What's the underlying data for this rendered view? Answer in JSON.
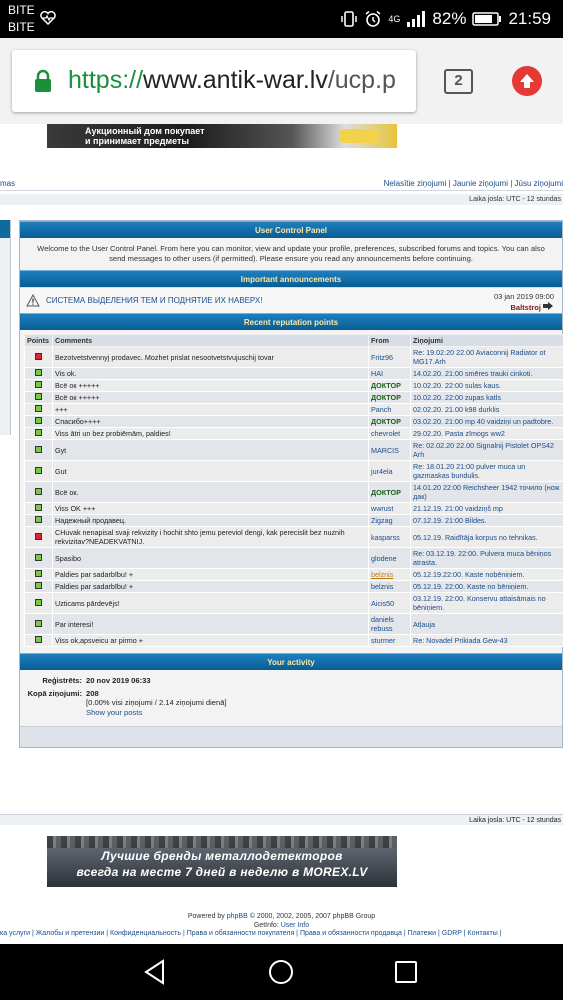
{
  "status_bar": {
    "carrier1": "BITE",
    "carrier2": "BITE",
    "net_label": "4G",
    "battery": "82%",
    "time": "21:59"
  },
  "browser": {
    "url_scheme": "https://",
    "url_host": "www.antik-war.lv",
    "url_path": "/ucp.p",
    "tab_count": "2"
  },
  "banner_top": {
    "line1": "Аукционный дом покупает",
    "line2": "и принимает предметы"
  },
  "top_links": {
    "left": "mas",
    "new_posts": "Nelasītie ziņojumi",
    "sep": " | ",
    "new_topics": "Jaunie ziņojumi",
    "your_posts": "Jūsu ziņojumi"
  },
  "timezone_top": "Laika josla: UTC - 12 stundas",
  "ucp": {
    "title": "User Control Panel",
    "welcome": "Welcome to the User Control Panel. From here you can monitor, view and update your profile, preferences, subscribed forums and topics. You can also send messages to other users (if permitted). Please ensure you read any announcements before continuing."
  },
  "announcements": {
    "title": "Important announcements",
    "items": [
      {
        "title": "СИСТЕМА ВЫДЕЛЕНИЯ ТЕМ И ПОДНЯТИЕ ИХ НАВЕРХ!",
        "date": "03 jan 2019 09:00",
        "author": "Baltstroj"
      }
    ]
  },
  "reputation": {
    "title": "Recent reputation points",
    "headers": {
      "points": "Points",
      "comments": "Comments",
      "from": "From",
      "post": "Ziņojumi"
    },
    "rows": [
      {
        "type": "neg",
        "comment": "Bezotvetstvennyj prodavec. Mozhet prislat nesootvetstvujuschij tovar",
        "from": "Fritz96",
        "post": "Re: 19.02.20 22.00 Aviaconnij Radiator ot MG17.Arh"
      },
      {
        "type": "pos",
        "comment": "Vis ok.",
        "from": "HAI",
        "post": "14.02.20. 21:00 smēres trauki cinkoti."
      },
      {
        "type": "pos",
        "comment": "Всё ок +++++",
        "from": "ДОКТОР",
        "post": "10.02.20. 22:00 sulas kaus."
      },
      {
        "type": "pos",
        "comment": "Всё ок +++++",
        "from": "ДОКТОР",
        "post": "10.02.20. 22:00 zupas katls"
      },
      {
        "type": "pos",
        "comment": "+++",
        "from": "Panch",
        "post": "02.02.20. 21.00 k98 durklis"
      },
      {
        "type": "pos",
        "comment": "Спасибо++++",
        "from": "ДОКТОР",
        "post": "03.02.20. 21:00 mp 40 vaidziņi un padtobre."
      },
      {
        "type": "pos",
        "comment": "Viss ātri un bez probiēmām, paldies!",
        "from": "chevrolet",
        "post": "29.02.20. Pasta zīmogs ww2"
      },
      {
        "type": "pos",
        "comment": "Gyt",
        "from": "MARCIS",
        "post": "Re: 02.02.20 22.00 Signalnij Pistolet OPS42 Arh"
      },
      {
        "type": "pos",
        "comment": "Gut",
        "from": "jur4ela",
        "post": "Re: 18.01.20 21:00 pulver muca un gazmaskas bundulis."
      },
      {
        "type": "pos",
        "comment": "Всё ок.",
        "from": "ДОКТОР",
        "post": "14.01.20 22:00 Reichsheer 1942 точило (нож дак)"
      },
      {
        "type": "pos",
        "comment": "Viss OK +++",
        "from": "wwrust",
        "post": "21.12.19. 21:00 vaidziņš mp"
      },
      {
        "type": "pos",
        "comment": "Надежный продавец.",
        "from": "Zigzag",
        "post": "07.12.19. 21:00 Bildes."
      },
      {
        "type": "neg",
        "comment": "CHuvak nenapisal svaji rekvizity i hochit shto jemu pereviol dengi, kak perecislit bez nuznih rekvizitav?NEADEKVATNIJ.",
        "from": "kasparss",
        "post": "05.12.19. Raidītāja korpus no tehnikas."
      },
      {
        "type": "pos",
        "comment": "Spasibo",
        "from": "glodene",
        "post": "Re: 03.12.19. 22:00. Pulvera muca bēniņos atrasta."
      },
      {
        "type": "pos",
        "comment": "Paldies par sadarbību! +",
        "from": "belznis",
        "post": "05.12.19.22:00. Kaste nobēniņiem.",
        "from_hl": true
      },
      {
        "type": "pos",
        "comment": "Paldies par sadarbību! +",
        "from": "belznis",
        "post": "05.12.19. 22:00. Kaste no bēniņiem."
      },
      {
        "type": "pos",
        "comment": "Uzticams pārdevējs!",
        "from": "Aicis50",
        "post": "03.12.19. 22:00. Konservu attaisāmais no bēniņiem."
      },
      {
        "type": "pos",
        "comment": "Par interesi!",
        "from": "daniels rebuss",
        "post": "Atļauja"
      },
      {
        "type": "pos",
        "comment": "Viss ok,apsveicu ar pirmo +",
        "from": "sturmer",
        "post": "Re: Novadel Prikiada Gew-43"
      }
    ]
  },
  "activity": {
    "title": "Your activity",
    "registered_label": "Reģistrēts:",
    "registered_value": "20 nov 2019 06:33",
    "posts_label": "Kopā ziņojumi:",
    "posts_value": "208",
    "posts_detail": "[0.00% visi ziņojumi / 2.14 ziņojumi dienā]",
    "show_posts": "Show your posts"
  },
  "timezone_bottom": "Laika josla: UTC - 12 stundas",
  "banner_bottom": {
    "line1": "Лучшие бренды металлодетекторов",
    "line2": "всегда на месте 7 дней в неделю в MOREX.LV"
  },
  "footer": {
    "powered_prefix": "Powered by ",
    "powered_link": "phpBB",
    "powered_suffix": " © 2000, 2002, 2005, 2007 phpBB Group",
    "getinfo_prefix": "GetInfo: ",
    "getinfo_link": "User Info",
    "links": "ка услуги | Жалобы и претензии | Конфиденциальность | Права и обязанности покупателя | Права и обязанности продавца | Платежи | GDRP | Контакты |"
  }
}
